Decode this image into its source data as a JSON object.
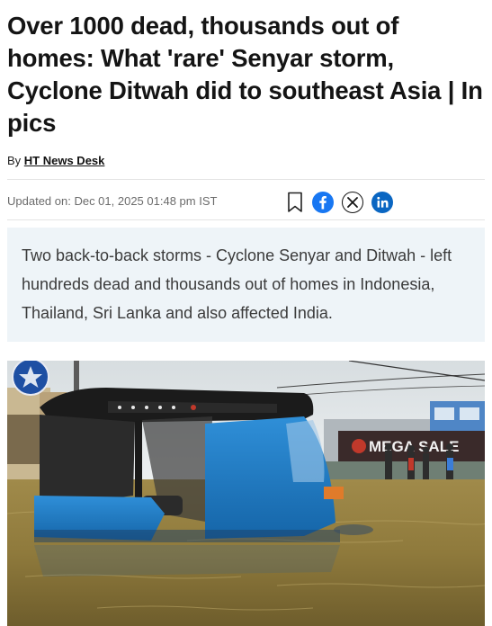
{
  "article": {
    "headline": "Over 1000 dead, thousands out of homes: What 'rare' Senyar storm, Cyclone Ditwah did to southeast Asia | In pics",
    "byline_prefix": "By ",
    "author": "HT News Desk",
    "updated": "Updated on: Dec 01, 2025 01:48 pm IST",
    "summary": "Two back-to-back storms - Cyclone Senyar and Ditwah - left hundreds dead and thousands out of homes in Indonesia, Thailand, Sri Lanka and also affected India."
  },
  "share": {
    "icons": [
      "bookmark-icon",
      "facebook-icon",
      "x-icon",
      "linkedin-icon"
    ],
    "colors": {
      "facebook": "#1877f2",
      "linkedin": "#0a66c2",
      "x": "#141414"
    }
  },
  "photo": {
    "shop_sign": "MEGA SALE"
  },
  "colors": {
    "summary_bg": "#eef4f8",
    "headline": "#141414",
    "meta_text": "#6b6b6b"
  }
}
